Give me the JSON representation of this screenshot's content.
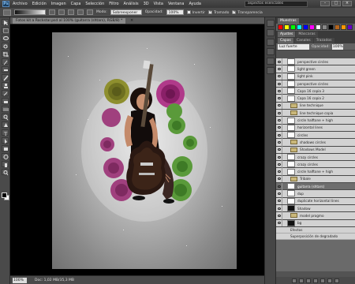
{
  "app": {
    "logo": "Ps"
  },
  "menu": [
    "Archivo",
    "Edición",
    "Imagen",
    "Capa",
    "Selección",
    "Filtro",
    "Análisis",
    "3D",
    "Vista",
    "Ventana",
    "Ayuda"
  ],
  "workspace": "aspectos esenciales",
  "window_controls": [
    "–",
    "□",
    "×"
  ],
  "options_bar": {
    "mode_label": "Modo:",
    "mode_value": "Sobreexponer c...",
    "opacity_label": "Opacidad:",
    "opacity_value": "100%",
    "invert_label": "Invertir",
    "dither_label": "Tramado",
    "transparency_label": "Transparencia"
  },
  "document": {
    "tab_title": "Fotos kit a Rockstar.psd al 100% (guitarra (shtars), RGB/8) *",
    "close": "×"
  },
  "status": {
    "zoom": "100%",
    "doc_info": "Doc: 1,02 MB/35,3 MB"
  },
  "panels": {
    "top_tabs": [
      "Muestras"
    ],
    "adjust_tabs": [
      "Ajustes",
      "Máscaras"
    ],
    "layer_tabs": [
      "Capas",
      "Canales",
      "Trazados"
    ],
    "blend_mode": "Luz fuerte",
    "opacity_label": "Opacidad:",
    "opacity_value": "100%",
    "lock_label": "Bloq.:",
    "fill_label": "Relleno:",
    "fill_value": "100%"
  },
  "swatch_colors": [
    "#ff0000",
    "#ffff00",
    "#00ff00",
    "#00ffff",
    "#0000ff",
    "#ff00ff",
    "#ffffff",
    "#888888",
    "#000000",
    "#b5651d",
    "#ff9900",
    "#6600cc"
  ],
  "layers": [
    {
      "name": "perspective circles",
      "type": "layer",
      "visible": true
    },
    {
      "name": "light green",
      "type": "layer",
      "visible": true
    },
    {
      "name": "light pink",
      "type": "layer",
      "visible": true
    },
    {
      "name": "perspective circles",
      "type": "layer",
      "visible": true
    },
    {
      "name": "Capa 16 copia 3",
      "type": "layer",
      "visible": true
    },
    {
      "name": "Capa 16 copia 2",
      "type": "layer",
      "visible": true
    },
    {
      "name": "line technique",
      "type": "group",
      "visible": true
    },
    {
      "name": "line technique copia",
      "type": "group",
      "visible": true
    },
    {
      "name": "circle halftone + high",
      "type": "layer",
      "visible": true
    },
    {
      "name": "horizontal lines",
      "type": "layer",
      "visible": true
    },
    {
      "name": "circles",
      "type": "layer",
      "visible": true
    },
    {
      "name": "shadows circles",
      "type": "group",
      "visible": true
    },
    {
      "name": "Shadows Model",
      "type": "group",
      "visible": true
    },
    {
      "name": "crazy circles",
      "type": "layer",
      "visible": true
    },
    {
      "name": "crazy circles",
      "type": "layer",
      "visible": true
    },
    {
      "name": "circle halftone + high",
      "type": "layer",
      "visible": true
    },
    {
      "name": "Tribale",
      "type": "group",
      "visible": true
    },
    {
      "name": "guitarra (shtars)",
      "type": "layer",
      "visible": true,
      "selected": true
    },
    {
      "name": "dup",
      "type": "layer",
      "visible": true
    },
    {
      "name": "duplicate horizontal lines",
      "type": "layer",
      "visible": true
    },
    {
      "name": "Shadow",
      "type": "layer",
      "visible": true,
      "dark": true
    },
    {
      "name": "model progmo",
      "type": "group",
      "visible": true
    },
    {
      "name": "bg",
      "type": "layer",
      "visible": true,
      "dark": true
    }
  ],
  "effects": [
    "Efectos",
    "Superposición de degradado"
  ]
}
